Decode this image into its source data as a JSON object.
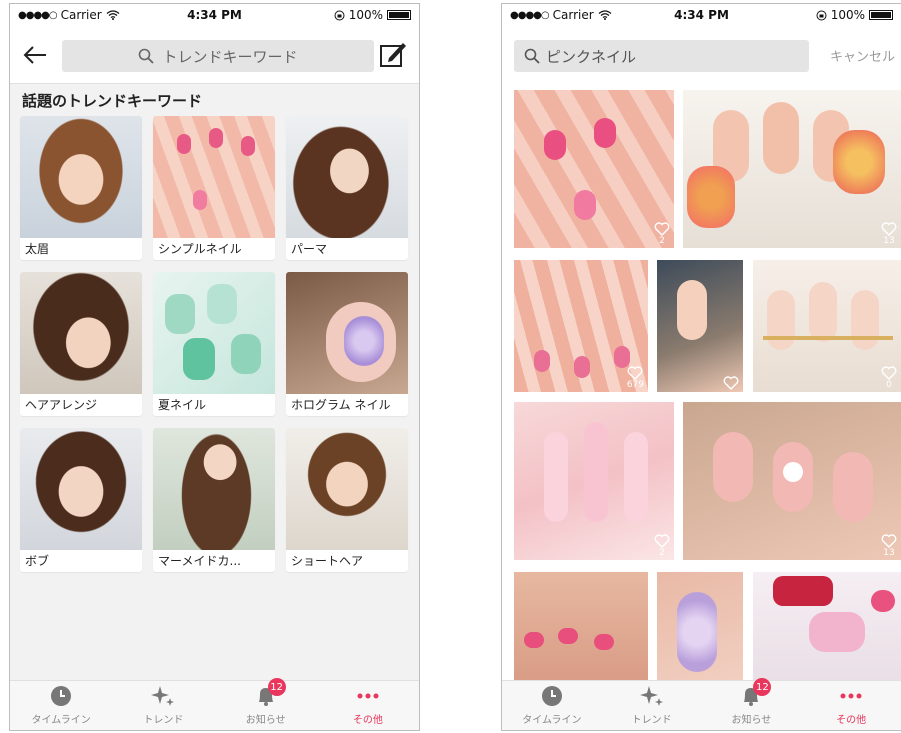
{
  "status_bar": {
    "carrier": "Carrier",
    "time": "4:34 PM",
    "battery": "100%"
  },
  "left_screen": {
    "search_placeholder": "トレンドキーワード",
    "section_title": "話題のトレンドキーワード",
    "keywords": [
      {
        "label": "太眉",
        "image": "portrait-short-brown-hair"
      },
      {
        "label": "シンプルネイル",
        "image": "nails-pink"
      },
      {
        "label": "パーマ",
        "image": "portrait-wavy-hair"
      },
      {
        "label": "ヘアアレンジ",
        "image": "portrait-side-bangs"
      },
      {
        "label": "夏ネイル",
        "image": "nails-mint"
      },
      {
        "label": "ホログラム ネイル",
        "image": "nails-hologram"
      },
      {
        "label": "ボブ",
        "image": "portrait-bob"
      },
      {
        "label": "マーメイドカ...",
        "image": "portrait-long-curls"
      },
      {
        "label": "ショートヘア",
        "image": "portrait-short-hair"
      }
    ]
  },
  "right_screen": {
    "search_value": "ピンクネイル",
    "cancel_label": "キャンセル",
    "like_counts": [
      "2",
      "13",
      "679",
      "",
      "0",
      "2",
      "13",
      "",
      "",
      ""
    ]
  },
  "tab_bar": {
    "tabs": [
      {
        "label": "タイムライン",
        "icon": "clock-icon"
      },
      {
        "label": "トレンド",
        "icon": "sparkle-icon"
      },
      {
        "label": "お知らせ",
        "icon": "bell-icon",
        "badge": "12"
      },
      {
        "label": "その他",
        "icon": "more-dots-icon"
      }
    ],
    "active_color": "#e8365d"
  }
}
